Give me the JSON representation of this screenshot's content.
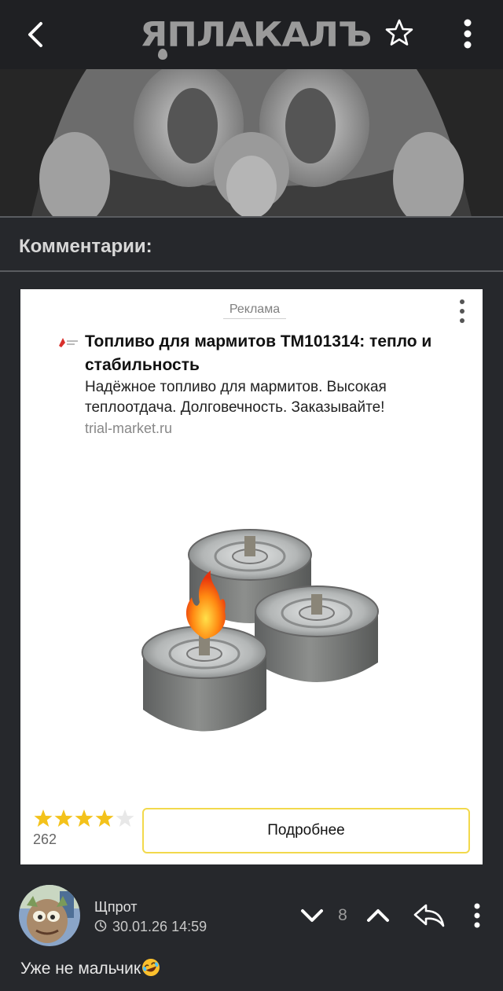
{
  "header": {
    "logo_text": "ЯПЛАКАЛЪ",
    "back_icon": "back-arrow-icon",
    "favorite_icon": "star-outline-icon",
    "menu_icon": "more-vertical-icon"
  },
  "comments_section": {
    "title": "Комментарии:"
  },
  "ad": {
    "label": "Реклама",
    "title": "Топливо для мармитов ТМ101314: тепло и стабильность",
    "description": "Надёжное топливо для мармитов. Высокая теплоотдача. Долговечность. Заказывайте!",
    "domain": "trial-market.ru",
    "rating_count": "262",
    "rating_stars": 4,
    "rating_max": 5,
    "cta_label": "Подробнее",
    "cta_border_color": "#f2d94c"
  },
  "comment": {
    "author": "Щпрот",
    "timestamp": "30.01.26 14:59",
    "votes": "8",
    "text": "Уже не мальчик",
    "emoji_icon": "rolling-on-floor-laughing-emoji"
  },
  "colors": {
    "background": "#26282c",
    "topbar": "#1f2023",
    "accent_star": "#f3c21b"
  }
}
